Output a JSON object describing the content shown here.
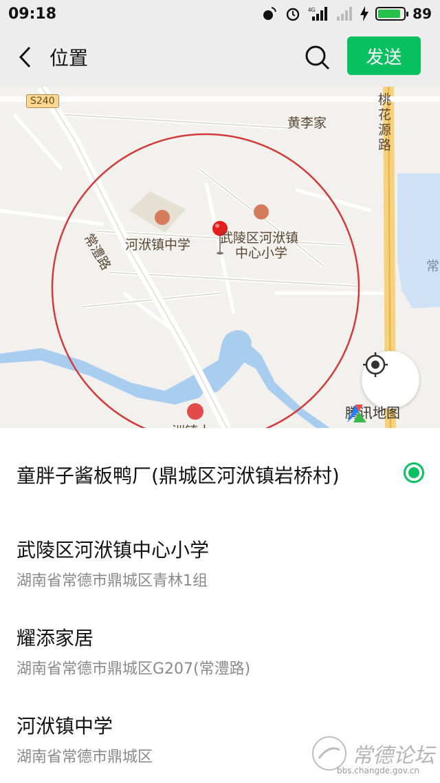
{
  "status_bar": {
    "time": "09:18",
    "battery": "89",
    "battery_level": 0.89
  },
  "header": {
    "back": "back",
    "title": "位置",
    "send_label": "发送"
  },
  "map": {
    "road_badge": "S240",
    "labels": {
      "huanglijia": "黄李家",
      "taohua_road": "桃花源路",
      "changli_road": "常澧路",
      "hezhen_school": "河洑镇中学",
      "wuling_school_line1": "武陵区河洑镇",
      "wuling_school_line2": "中心小学",
      "partial_right": "常",
      "partial_bottom": "洲镇人"
    },
    "brand": "腾讯地图"
  },
  "locations": [
    {
      "name": "童胖子酱板鸭厂(鼎城区河洑镇岩桥村)",
      "address": "",
      "selected": true
    },
    {
      "name": "武陵区河洑镇中心小学",
      "address": "湖南省常德市鼎城区青林1组"
    },
    {
      "name": "耀添家居",
      "address": "湖南省常德市鼎城区G207(常澧路)"
    },
    {
      "name": "河洑镇中学",
      "address": "湖南省常德市鼎城区"
    }
  ],
  "watermark": {
    "text": "常德论坛",
    "url": "bbs.changde.gov.cn"
  },
  "colors": {
    "accent": "#07c160",
    "radius_circle": "#d23a3a",
    "water": "#a9cdef"
  }
}
